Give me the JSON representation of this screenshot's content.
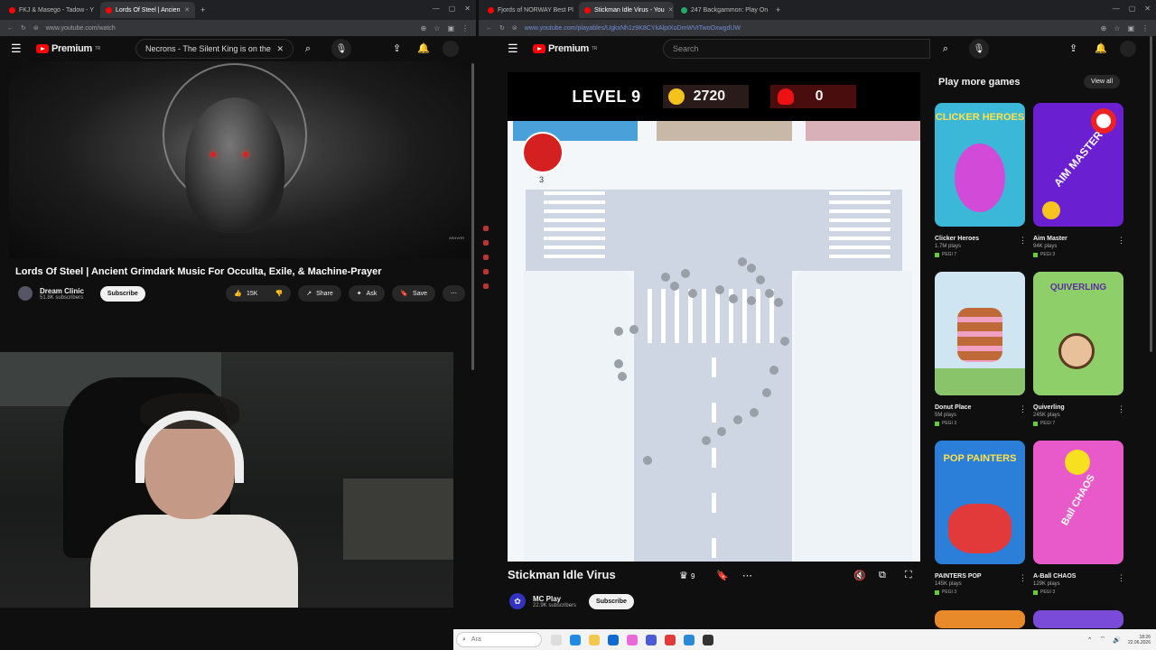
{
  "left": {
    "tabs": [
      {
        "label": "FKJ & Masego - Tadow - Y",
        "active": false
      },
      {
        "label": "Lords Of Steel | Ancien",
        "active": true
      }
    ],
    "url": "www.youtube.com/watch",
    "search_value": "Necrons - The Silent King is on the Flo",
    "video_title": "Lords Of Steel | Ancient Grimdark Music For Occulta, Exile, & Machine-Prayer",
    "channel_name": "Dream Clinic",
    "subscribers": "51.8K subscribers",
    "subscribe_label": "Subscribe",
    "likes": "15K",
    "share_label": "Share",
    "ask_label": "Ask",
    "save_label": "Save",
    "watermark": "ASHVOR"
  },
  "right": {
    "tabs": [
      {
        "label": "Fjords of NORWAY Best Pl",
        "active": false
      },
      {
        "label": "Stickman Idle Virus - You",
        "active": true
      },
      {
        "label": "247 Backgammon: Play On",
        "active": false
      }
    ],
    "url": "www.youtube.com/playables/UgkxNh1z9K8CYkAlpIXoDmWVtTwoOxwgdUW",
    "search_placeholder": "Search",
    "premium_label": "Premium",
    "hud": {
      "level": "LEVEL 9",
      "coins": "2720",
      "kills": "0"
    },
    "grenade_count": "3",
    "game_title": "Stickman Idle Virus",
    "crown_count": "9",
    "channel_name": "MC Play",
    "subscribers": "22.9K subscribers",
    "subscribe_label": "Subscribe",
    "side_title": "Play more games",
    "view_all": "View all",
    "games": [
      {
        "name": "Clicker Heroes",
        "plays": "1.7M plays",
        "pegi": "PEGI 7",
        "color": "#3bb8d8",
        "art": "CLICKER HEROES"
      },
      {
        "name": "Aim Master",
        "plays": "94K plays",
        "pegi": "PEGI 3",
        "color": "#6a1fd1",
        "art": "AIM MASTER"
      },
      {
        "name": "Donut Place",
        "plays": "5M plays",
        "pegi": "PEGI 3",
        "color": "#cfe6f2",
        "art": ""
      },
      {
        "name": "Quiverling",
        "plays": "245K plays",
        "pegi": "PEGI 7",
        "color": "#8fcf6a",
        "art": "QUIVERLING"
      },
      {
        "name": "PAINTERS POP",
        "plays": "145K plays",
        "pegi": "PEGI 3",
        "color": "#2b7fd8",
        "art": "POP PAINTERS"
      },
      {
        "name": "A-Ball CHAOS",
        "plays": "129K plays",
        "pegi": "PEGI 3",
        "color": "#e85ac9",
        "art": "Ball CHAOS"
      }
    ]
  },
  "taskbar": {
    "search_placeholder": "Ara",
    "time": "18:26",
    "date": "22.06.2026"
  },
  "premium_label": "Premium"
}
